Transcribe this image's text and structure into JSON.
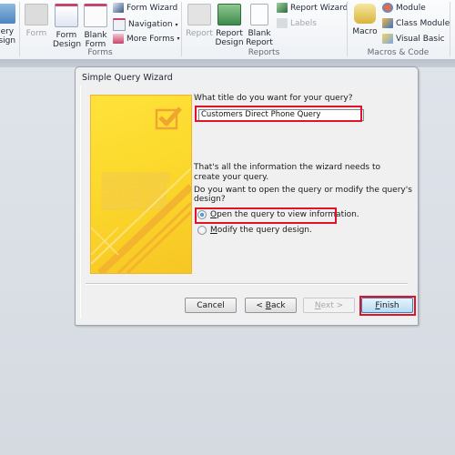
{
  "ribbon": {
    "partial_left_label": "uery\nesign",
    "groups": [
      {
        "label": "Forms",
        "large_buttons": [
          {
            "label": "Form",
            "enabled": false,
            "icon": "form-icon"
          },
          {
            "label": "Form Design",
            "enabled": true,
            "icon": "form-design-icon"
          },
          {
            "label": "Blank Form",
            "enabled": true,
            "icon": "blank-form-icon"
          }
        ],
        "small_buttons": [
          {
            "label": "Form Wizard",
            "enabled": true,
            "icon": "form-wizard-icon",
            "dropdown": false
          },
          {
            "label": "Navigation",
            "enabled": true,
            "icon": "navigation-icon",
            "dropdown": true
          },
          {
            "label": "More Forms",
            "enabled": true,
            "icon": "more-forms-icon",
            "dropdown": true
          }
        ]
      },
      {
        "label": "Reports",
        "large_buttons": [
          {
            "label": "Report",
            "enabled": false,
            "icon": "report-icon"
          },
          {
            "label": "Report Design",
            "enabled": true,
            "icon": "report-design-icon"
          },
          {
            "label": "Blank Report",
            "enabled": true,
            "icon": "blank-report-icon"
          }
        ],
        "small_buttons": [
          {
            "label": "Report Wizard",
            "enabled": true,
            "icon": "report-wizard-icon"
          },
          {
            "label": "Labels",
            "enabled": false,
            "icon": "labels-icon"
          }
        ]
      },
      {
        "label": "Macros & Code",
        "large_buttons": [
          {
            "label": "Macro",
            "enabled": true,
            "icon": "macro-icon"
          }
        ],
        "small_buttons": [
          {
            "label": "Module",
            "enabled": true,
            "icon": "module-icon"
          },
          {
            "label": "Class Module",
            "enabled": true,
            "icon": "class-module-icon"
          },
          {
            "label": "Visual Basic",
            "enabled": true,
            "icon": "visual-basic-icon"
          }
        ]
      }
    ]
  },
  "dialog": {
    "title": "Simple Query Wizard",
    "title_question": "What title do you want for your query?",
    "title_value": "Customers Direct Phone Query",
    "info_text": "That's all the information the wizard needs to create your query.",
    "open_question": "Do you want to open the query or modify the query's design?",
    "options": [
      {
        "label_u": "O",
        "label_rest": "pen the query to view information.",
        "selected": true
      },
      {
        "label_u": "M",
        "label_rest": "odify the query design.",
        "selected": false
      }
    ],
    "buttons": {
      "cancel": "Cancel",
      "back_prefix": "< ",
      "back_u": "B",
      "back_rest": "ack",
      "next_u": "N",
      "next_rest": "ext >",
      "finish_u": "F",
      "finish_rest": "inish"
    }
  },
  "colors": {
    "highlight": "#e01428",
    "wizard_art": "#fcd92c",
    "default_button": "#b9dcf4"
  }
}
